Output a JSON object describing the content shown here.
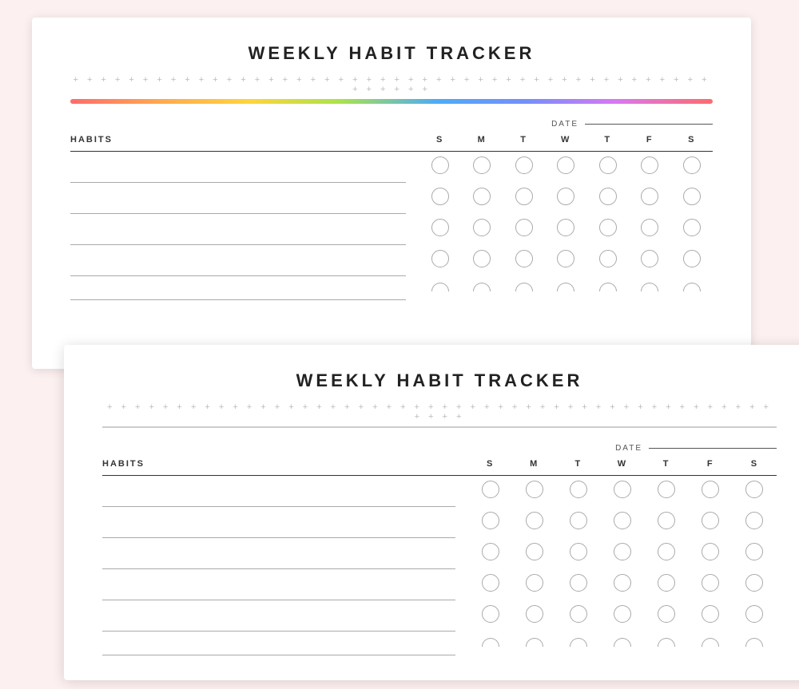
{
  "cards": [
    {
      "id": "card-back",
      "title": "WEEKLY HABIT TRACKER",
      "dotted": "+ + + + + + + + + + + + + + + + + + + + + + + + + + + + + + + + + + + + + + + + + + + + + + + + + + + +",
      "has_rainbow": true,
      "date_label": "DATE",
      "headers": [
        "HABITS",
        "S",
        "M",
        "T",
        "W",
        "T",
        "F",
        "S"
      ],
      "rows": 5,
      "show_partial_last": true
    },
    {
      "id": "card-front",
      "title": "WEEKLY HABIT TRACKER",
      "dotted": "+ + + + + + + + + + + + + + + + + + + + + + + + + + + + + + + + + + + + + + + + + + + + + + + + + + + +",
      "has_rainbow": false,
      "date_label": "DATE",
      "headers": [
        "HABITS",
        "S",
        "M",
        "T",
        "W",
        "T",
        "F",
        "S"
      ],
      "rows": 6,
      "show_partial_last": true
    }
  ]
}
